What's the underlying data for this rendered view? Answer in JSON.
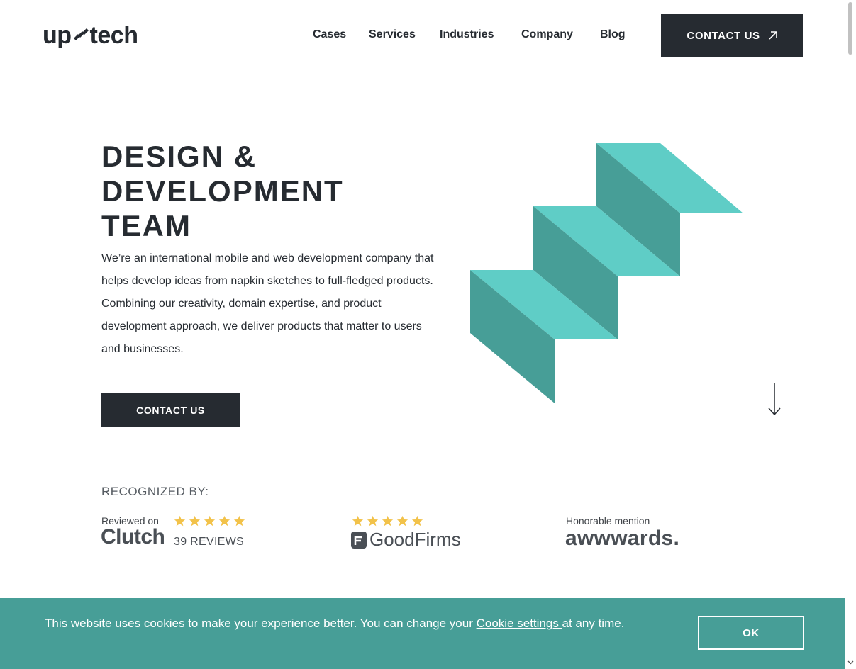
{
  "header": {
    "logo_text_left": "up",
    "logo_text_right": "tech",
    "nav": [
      {
        "label": "Cases"
      },
      {
        "label": "Services"
      },
      {
        "label": "Industries"
      },
      {
        "label": "Company"
      },
      {
        "label": "Blog"
      }
    ],
    "cta_label": "CONTACT US",
    "cta_icon": "arrow-up-right-icon"
  },
  "hero": {
    "title_lines": [
      "DESIGN &",
      "DEVELOPMENT",
      "TEAM"
    ],
    "description": "We’re an international mobile and web development company that helps develop ideas from napkin sketches to full-fledged products. Combining our creativity, domain expertise, and product development approach, we deliver products that matter to users and businesses.",
    "cta_label": "CONTACT US",
    "illustration": "stairs-illustration",
    "scroll_icon": "arrow-down-icon"
  },
  "recognition": {
    "heading": "RECOGNIZED BY:",
    "clutch": {
      "reviewed_on": "Reviewed on",
      "name": "Clutch",
      "rating": 5,
      "reviews": "39 REVIEWS"
    },
    "goodfirms": {
      "name": "GoodFirms",
      "rating": 5
    },
    "awwwards": {
      "label": "Honorable mention",
      "name": "awwwards."
    }
  },
  "cookie": {
    "text_before": "This website uses cookies to make your experience better. You can change your ",
    "link": "Cookie settings ",
    "text_after": "at any time.",
    "ok_label": "OK"
  },
  "colors": {
    "dark": "#262b31",
    "teal_light": "#5fcdc6",
    "teal_dark": "#479e97",
    "star": "#f2c24a",
    "cookie_bg": "#479e97"
  }
}
